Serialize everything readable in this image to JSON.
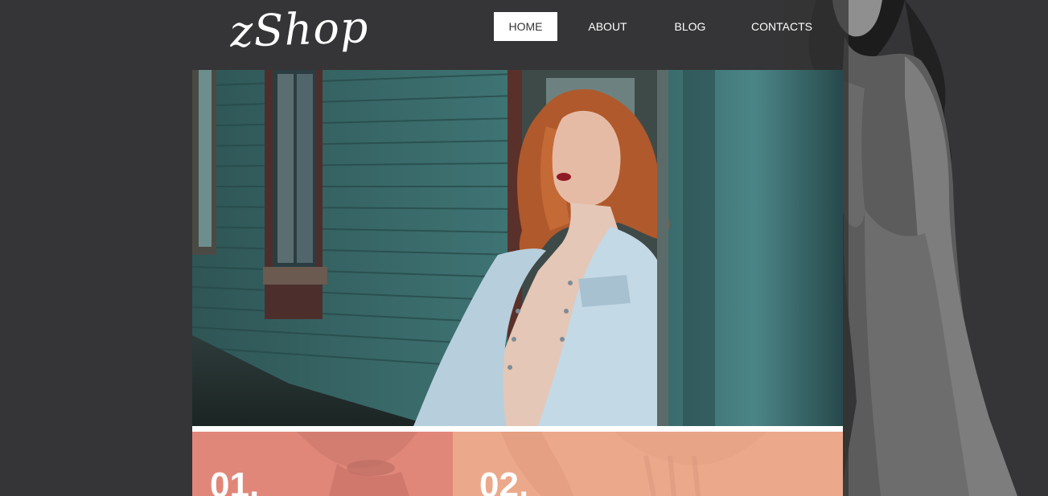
{
  "brand": {
    "logo_text": "zShop"
  },
  "nav": {
    "items": [
      {
        "label": "HOME",
        "active": true
      },
      {
        "label": "ABOUT",
        "active": false
      },
      {
        "label": "BLOG",
        "active": false
      },
      {
        "label": "CONTACTS",
        "active": false
      }
    ]
  },
  "hero": {
    "image": "woman-in-denim-jacket-leaning-on-teal-wooden-wall"
  },
  "tiles": [
    {
      "number": "01.",
      "color": "#e0877a"
    },
    {
      "number": "02.",
      "color": "#eca88b"
    }
  ],
  "colors": {
    "background": "#353436",
    "nav_active_bg": "#ffffff",
    "divider": "#ffffff"
  }
}
